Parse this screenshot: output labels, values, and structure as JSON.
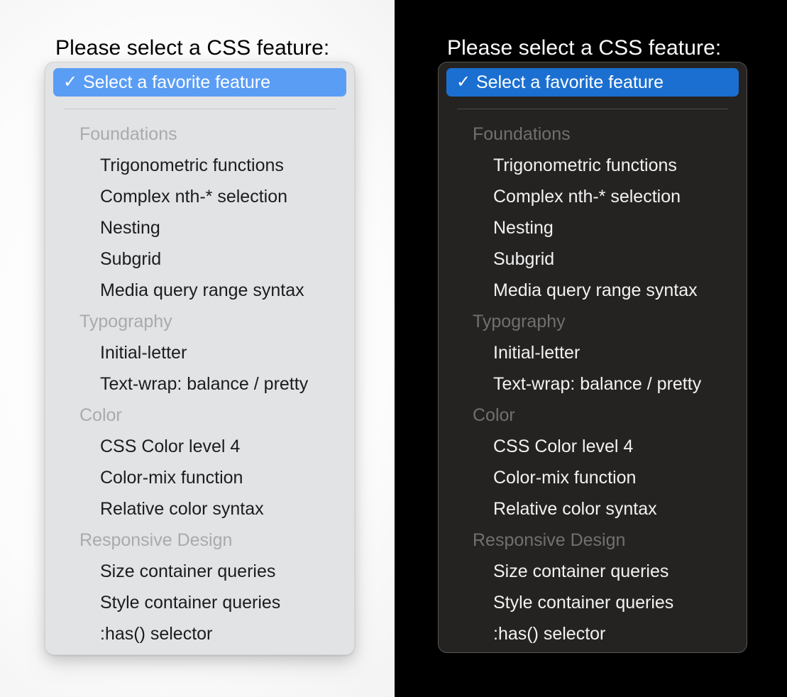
{
  "panes": {
    "light": {
      "name": "light-mode-pane",
      "title": "Please select a CSS feature:"
    },
    "dark": {
      "name": "dark-mode-pane",
      "title": "Please select a CSS feature:"
    }
  },
  "select": {
    "selected_option": "Select a favorite feature",
    "check_icon": "✓",
    "check_icon_name": "checkmark-icon",
    "groups": [
      {
        "label": "Foundations",
        "options": [
          "Trigonometric functions",
          "Complex nth-* selection",
          "Nesting",
          "Subgrid",
          "Media query range syntax"
        ]
      },
      {
        "label": "Typography",
        "options": [
          "Initial-letter",
          "Text-wrap: balance / pretty"
        ]
      },
      {
        "label": "Color",
        "options": [
          "CSS Color level 4",
          "Color-mix function",
          "Relative color syntax"
        ]
      },
      {
        "label": "Responsive Design",
        "options": [
          "Size container queries",
          "Style container queries",
          ":has() selector"
        ]
      }
    ]
  },
  "colors": {
    "light_background": "#fcfcfc",
    "light_popup_background": "#e2e3e5",
    "light_highlight": "#5a9df5",
    "light_text": "#1c1c1e",
    "light_group_text": "#a9aaac",
    "dark_background": "#000000",
    "dark_popup_background": "#252322",
    "dark_highlight": "#1b6fd0",
    "dark_text": "#f2f2f2",
    "dark_group_text": "#72706d",
    "selected_text": "#ffffff"
  }
}
